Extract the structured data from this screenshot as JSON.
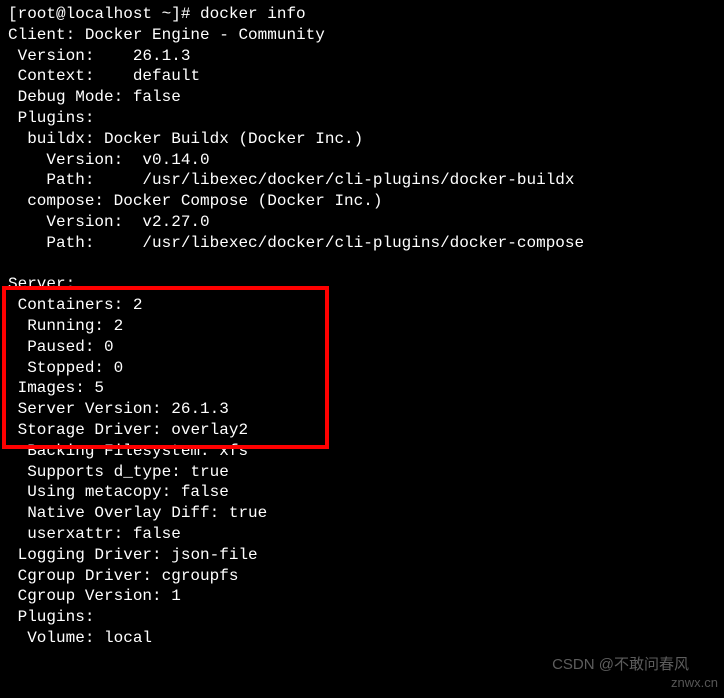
{
  "prompt": "[root@localhost ~]# ",
  "command": "docker info",
  "client": {
    "title": "Client: Docker Engine - Community",
    "version_label": " Version:    ",
    "version": "26.1.3",
    "context_label": " Context:    ",
    "context": "default",
    "debug_label": " Debug Mode: ",
    "debug": "false",
    "plugins_label": " Plugins:",
    "buildx": {
      "header": "  buildx: Docker Buildx (Docker Inc.)",
      "version_label": "    Version:  ",
      "version": "v0.14.0",
      "path_label": "    Path:     ",
      "path": "/usr/libexec/docker/cli-plugins/docker-buildx"
    },
    "compose": {
      "header": "  compose: Docker Compose (Docker Inc.)",
      "version_label": "    Version:  ",
      "version": "v2.27.0",
      "path_label": "    Path:     ",
      "path": "/usr/libexec/docker/cli-plugins/docker-compose"
    }
  },
  "server": {
    "title": "Server:",
    "containers_label": " Containers: ",
    "containers": "2",
    "running_label": "  Running: ",
    "running": "2",
    "paused_label": "  Paused: ",
    "paused": "0",
    "stopped_label": "  Stopped: ",
    "stopped": "0",
    "images_label": " Images: ",
    "images": "5",
    "server_version_label": " Server Version: ",
    "server_version": "26.1.3",
    "storage_driver_label": " Storage Driver: ",
    "storage_driver": "overlay2",
    "backing_fs_label": "  Backing Filesystem: ",
    "backing_fs": "xfs",
    "supports_dtype_label": "  Supports d_type: ",
    "supports_dtype": "true",
    "using_metacopy_label": "  Using metacopy: ",
    "using_metacopy": "false",
    "native_overlay_label": "  Native Overlay Diff: ",
    "native_overlay": "true",
    "userxattr_label": "  userxattr: ",
    "userxattr": "false",
    "logging_driver_label": " Logging Driver: ",
    "logging_driver": "json-file",
    "cgroup_driver_label": " Cgroup Driver: ",
    "cgroup_driver": "cgroupfs",
    "cgroup_version_label": " Cgroup Version: ",
    "cgroup_version": "1",
    "plugins_label": " Plugins:",
    "volume_label": "  Volume: ",
    "volume": "local"
  },
  "watermark1": "CSDN @不敢问春风",
  "watermark2": "znwx.cn"
}
